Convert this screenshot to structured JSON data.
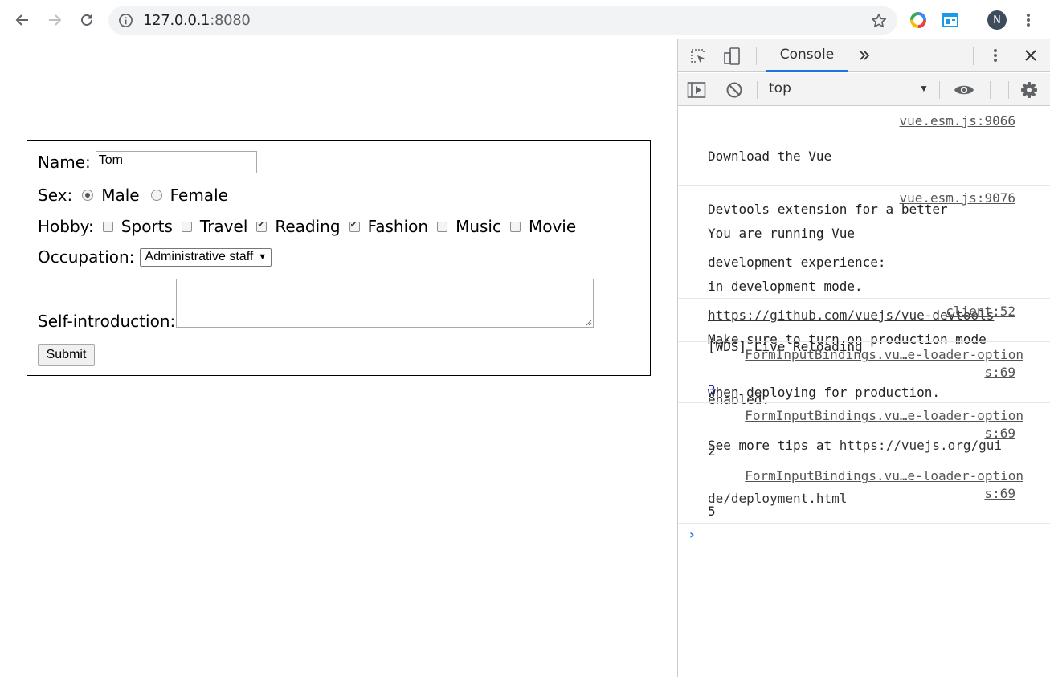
{
  "browser": {
    "url_host": "127.0.0.1",
    "url_port": ":8080",
    "profile_initial": "N"
  },
  "form": {
    "name_label": "Name:",
    "name_value": "Tom",
    "sex_label": "Sex:",
    "sex_options": [
      {
        "label": "Male",
        "checked": true
      },
      {
        "label": "Female",
        "checked": false
      }
    ],
    "hobby_label": "Hobby:",
    "hobbies": [
      {
        "label": "Sports",
        "checked": false
      },
      {
        "label": "Travel",
        "checked": false
      },
      {
        "label": "Reading",
        "checked": true
      },
      {
        "label": "Fashion",
        "checked": true
      },
      {
        "label": "Music",
        "checked": false
      },
      {
        "label": "Movie",
        "checked": false
      }
    ],
    "occupation_label": "Occupation:",
    "occupation_value": "Administrative staff",
    "intro_label": "Self-introduction:",
    "intro_value": "",
    "submit_label": "Submit"
  },
  "devtools": {
    "tab_console": "Console",
    "context": "top",
    "messages": [
      {
        "lines": [
          "Download the Vue",
          "Devtools extension for a better",
          "development experience:"
        ],
        "link": "https://github.com/vuejs/vue-devtools",
        "source": "vue.esm.js:9066"
      },
      {
        "lines": [
          "You are running Vue",
          "in development mode.",
          "Make sure to turn on production mode",
          "when deploying for production.",
          "See more tips at "
        ],
        "link1": "https://vuejs.org/gui",
        "link2": "de/deployment.html",
        "source": "vue.esm.js:9076"
      },
      {
        "lines": [
          "[WDS] Live Reloading",
          "enabled."
        ],
        "source": "client:52"
      },
      {
        "source_line1": "FormInputBindings.vu…e-loader-option",
        "source_line2": "s:69",
        "value": "3"
      },
      {
        "source_line1": "FormInputBindings.vu…e-loader-option",
        "source_line2": "s:69",
        "value": "2"
      },
      {
        "source_line1": "FormInputBindings.vu…e-loader-option",
        "source_line2": "s:69",
        "value": "5"
      }
    ]
  }
}
